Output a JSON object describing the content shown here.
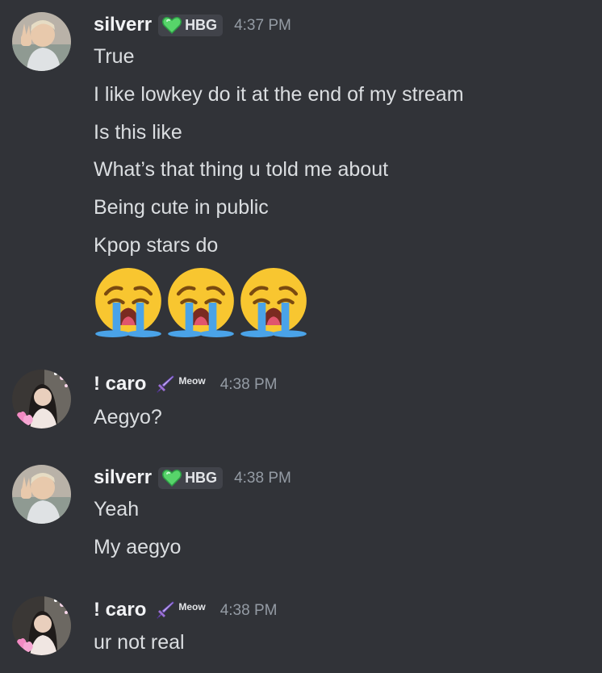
{
  "messages": [
    {
      "username": "silverr",
      "tag": "HBG",
      "tag_icon": "green-heart-icon",
      "timestamp": "4:37 PM",
      "lines": [
        "True",
        "I like lowkey do it at the end of my stream",
        "Is this like",
        "What’s that thing u told me about",
        "Being cute in public",
        "Kpop stars do"
      ],
      "emojis": [
        "loudly-crying-face",
        "loudly-crying-face",
        "loudly-crying-face"
      ]
    },
    {
      "username": "! caro",
      "tag": "Meow",
      "tag_icon": "sword-icon",
      "timestamp": "4:38 PM",
      "lines": [
        "Aegyo?"
      ]
    },
    {
      "username": "silverr",
      "tag": "HBG",
      "tag_icon": "green-heart-icon",
      "timestamp": "4:38 PM",
      "lines": [
        "Yeah",
        "My aegyo"
      ]
    },
    {
      "username": "! caro",
      "tag": "Meow",
      "tag_icon": "sword-icon",
      "timestamp": "4:38 PM",
      "lines": [
        "ur not real"
      ]
    }
  ],
  "colors": {
    "background": "#313338",
    "username": "#f2f3f5",
    "message_text": "#dbdee1",
    "timestamp": "#949ba4",
    "tag_bg": "#41434a",
    "heart_green": "#57d46a",
    "sword_purple": "#9b6fd6"
  }
}
